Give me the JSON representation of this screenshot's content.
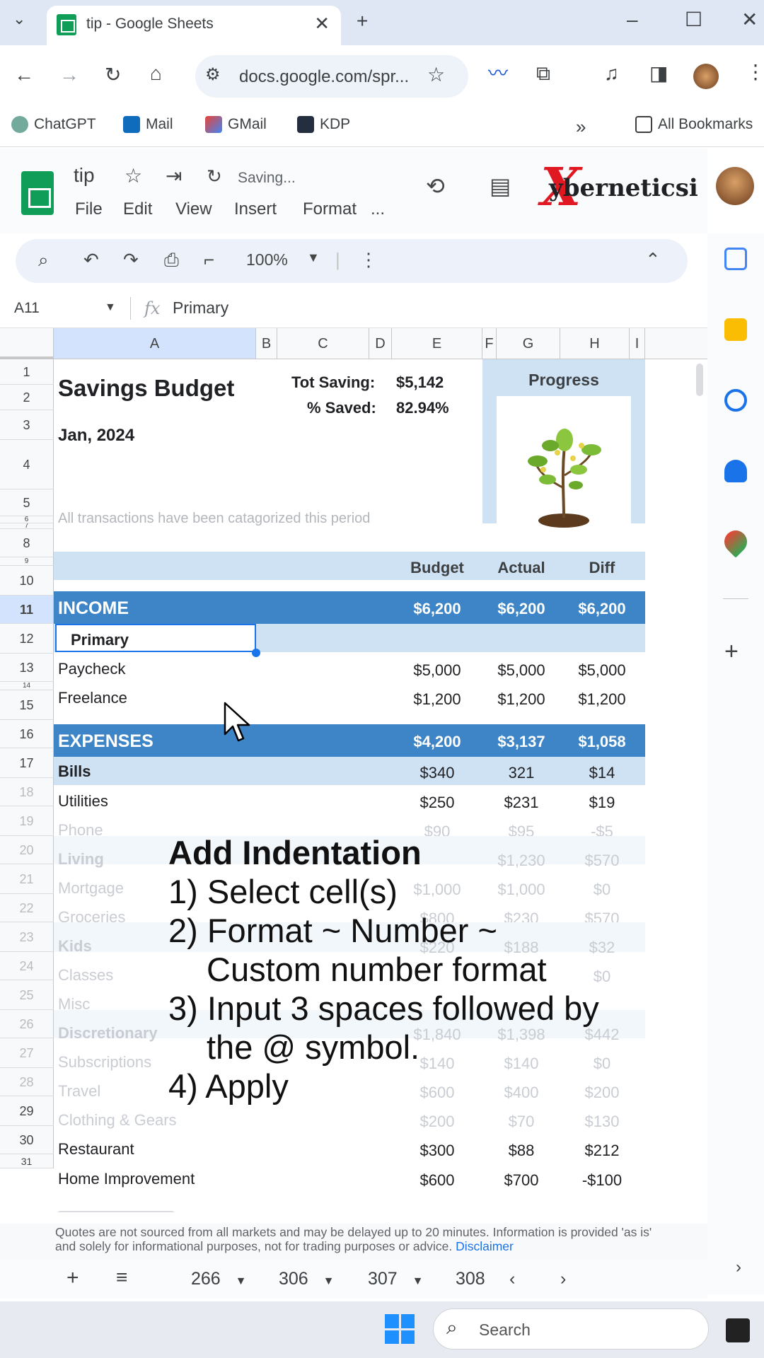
{
  "browser": {
    "tab_title": "tip - Google Sheets",
    "url": "docs.google.com/spr...",
    "bookmarks": [
      "ChatGPT",
      "Mail",
      "GMail",
      "KDP",
      "All Bookmarks"
    ]
  },
  "doc": {
    "title": "tip",
    "status": "Saving...",
    "menu": [
      "File",
      "Edit",
      "View",
      "Insert",
      "Format",
      "..."
    ],
    "brand": "yberneticsi",
    "brand_mark": "X"
  },
  "toolbar": {
    "zoom": "100%"
  },
  "formula_bar": {
    "cell_ref": "A11",
    "fx_label": "fx",
    "value": "Primary"
  },
  "columns": [
    "A",
    "B",
    "C",
    "D",
    "E",
    "F",
    "G",
    "H",
    "I"
  ],
  "rows": [
    "1",
    "2",
    "3",
    "4",
    "5",
    "6",
    "7",
    "8",
    "9",
    "10",
    "11",
    "12",
    "13",
    "14",
    "15",
    "16",
    "17",
    "18",
    "19",
    "20",
    "21",
    "22",
    "23",
    "24",
    "25",
    "26",
    "27",
    "28",
    "29",
    "30",
    "31"
  ],
  "sheet": {
    "title": "Savings Budget",
    "period": "Jan, 2024",
    "note": "All transactions have been catagorized this period",
    "tot_saving_label": "Tot Saving:",
    "tot_saving_value": "$5,142",
    "pct_saved_label": "% Saved:",
    "pct_saved_value": "82.94%",
    "progress_label": "Progress",
    "headers": {
      "budget": "Budget",
      "actual": "Actual",
      "diff": "Diff"
    },
    "income": {
      "label": "INCOME",
      "budget": "$6,200",
      "actual": "$6,200",
      "diff": "$6,200"
    },
    "primary": "Primary",
    "paycheck": {
      "label": "Paycheck",
      "budget": "$5,000",
      "actual": "$5,000",
      "diff": "$5,000"
    },
    "freelance": {
      "label": "Freelance",
      "budget": "$1,200",
      "actual": "$1,200",
      "diff": "$1,200"
    },
    "expenses": {
      "label": "EXPENSES",
      "budget": "$4,200",
      "actual": "$3,137",
      "diff": "$1,058"
    },
    "bills": {
      "label": "Bills",
      "budget": "$340",
      "actual": "321",
      "diff": "$14"
    },
    "utilities": {
      "label": "Utilities",
      "budget": "$250",
      "actual": "$231",
      "diff": "$19"
    },
    "phone": {
      "label": "Phone",
      "budget": "$90",
      "actual": "$95",
      "diff": "-$5"
    },
    "living": {
      "label": "Living",
      "budget": "",
      "actual": "$1,230",
      "diff": "$570"
    },
    "mortgage": {
      "label": "Mortgage",
      "budget": "$1,000",
      "actual": "$1,000",
      "diff": "$0"
    },
    "groceries": {
      "label": "Groceries",
      "budget": "$800",
      "actual": "$230",
      "diff": "$570"
    },
    "kids": {
      "label": "Kids",
      "budget": "$220",
      "actual": "$188",
      "diff": "$32"
    },
    "classes": {
      "label": "Classes",
      "budget": "",
      "actual": "",
      "diff": "$0"
    },
    "misc": {
      "label": "Misc",
      "budget": "",
      "actual": "",
      "diff": ""
    },
    "discretionary": {
      "label": "Discretionary",
      "budget": "$1,840",
      "actual": "$1,398",
      "diff": "$442"
    },
    "subscriptions": {
      "label": "Subscriptions",
      "budget": "$140",
      "actual": "$140",
      "diff": "$0"
    },
    "travel": {
      "label": "Travel",
      "budget": "$600",
      "actual": "$400",
      "diff": "$200"
    },
    "clothing": {
      "label": "Clothing & Gears",
      "budget": "$200",
      "actual": "$70",
      "diff": "$130"
    },
    "restaurant": {
      "label": "Restaurant",
      "budget": "$300",
      "actual": "$88",
      "diff": "$212"
    },
    "home": {
      "label": "Home Improvement",
      "budget": "$600",
      "actual": "$700",
      "diff": "-$100"
    }
  },
  "overlay": {
    "title": "Add Indentation",
    "line1": "1) Select cell(s)",
    "line2": "2) Format ~ Number ~",
    "line2b": "Custom number format",
    "line3": "3) Input 3 spaces followed by",
    "line3b": "the @ symbol.",
    "line4": "4) Apply"
  },
  "footer": {
    "disclaimer": "Quotes are not sourced from all markets and may be delayed up to 20 minutes. Information is provided 'as is' and solely for informational purposes, not for trading purposes or advice.",
    "link": "Disclaimer"
  },
  "sheet_tabs": [
    "266",
    "306",
    "307",
    "308"
  ],
  "taskbar": {
    "search_placeholder": "Search"
  },
  "colors": {
    "band_dark": "#3d85c6",
    "band_light": "#cfe2f3",
    "sheets_green": "#0f9d58",
    "brand_red": "#e01822"
  }
}
